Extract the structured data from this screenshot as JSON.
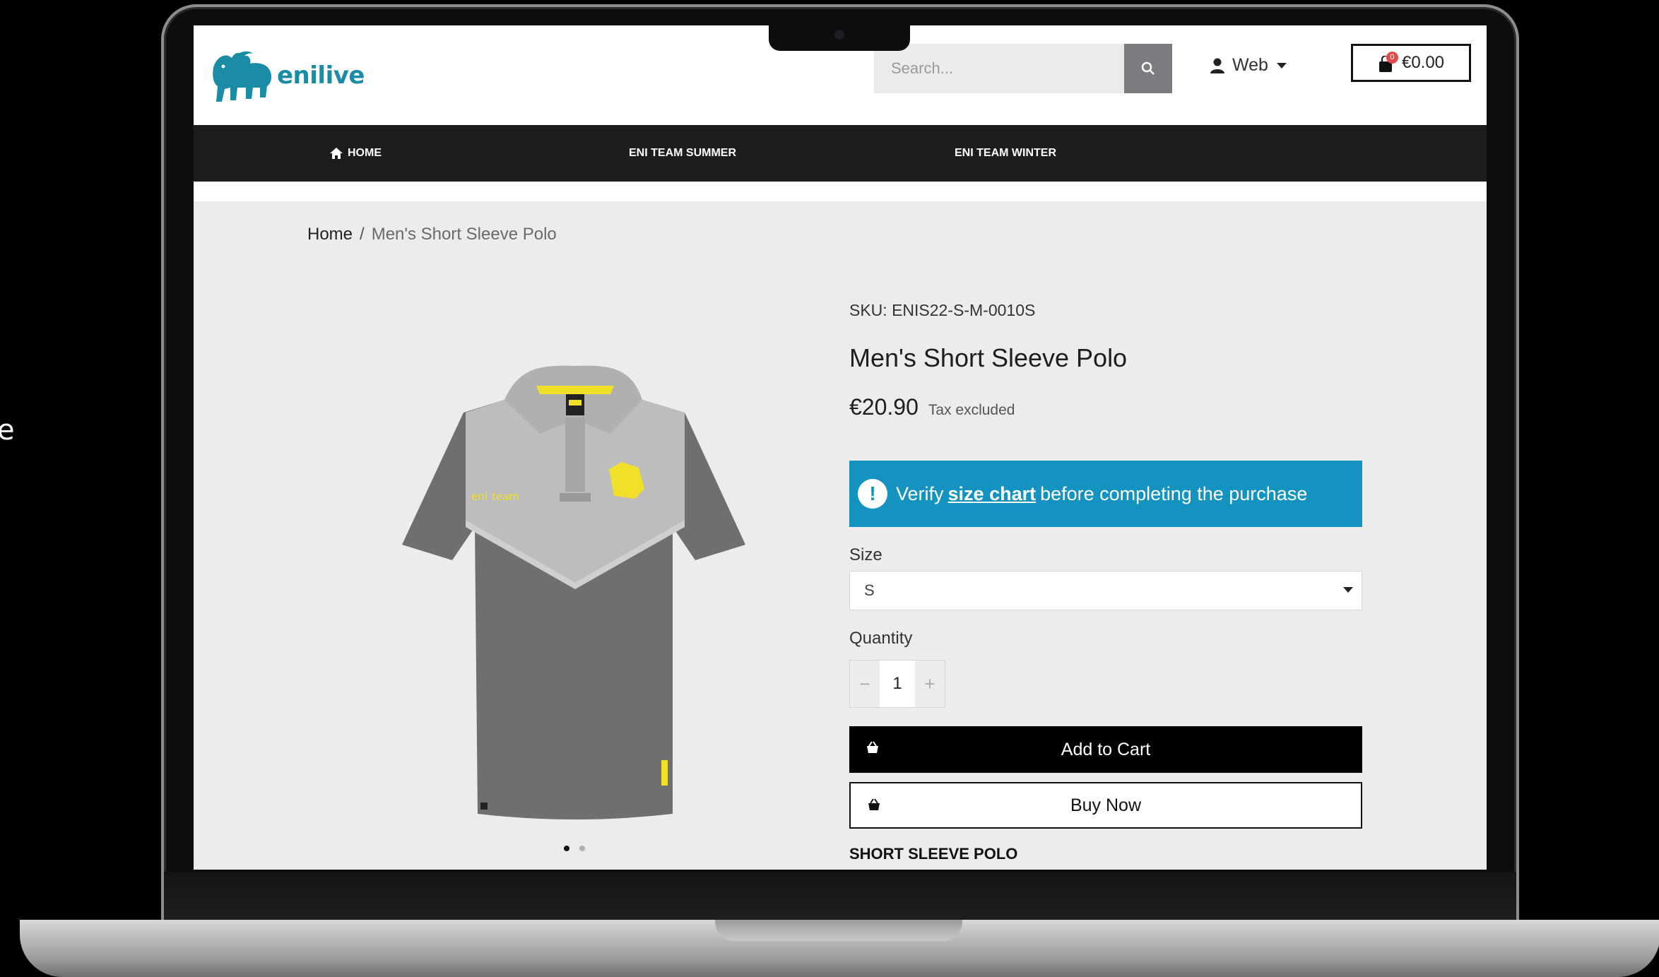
{
  "backdrop": {
    "side_text": "e"
  },
  "header": {
    "brand": "enilive",
    "search_placeholder": "Search...",
    "account_label": "Web",
    "cart_count": "0",
    "cart_total": "€0.00"
  },
  "nav": {
    "items": [
      {
        "label": "HOME",
        "icon": "home-icon"
      },
      {
        "label": "ENI TEAM SUMMER"
      },
      {
        "label": "ENI TEAM WINTER"
      }
    ]
  },
  "breadcrumb": {
    "home": "Home",
    "separator": "/",
    "current": "Men's Short Sleeve Polo"
  },
  "product": {
    "sku": "SKU: ENIS22-S-M-0010S",
    "title": "Men's Short Sleeve Polo",
    "price": "€20.90",
    "tax_note": "Tax excluded",
    "alert": {
      "prefix": "Verify",
      "link": "size chart",
      "suffix": "before completing the purchase"
    },
    "size_label": "Size",
    "size_value": "S",
    "quantity_label": "Quantity",
    "quantity_value": "1",
    "qty_minus": "−",
    "qty_plus": "+",
    "add_to_cart": "Add to Cart",
    "buy_now": "Buy Now",
    "description_heading": "SHORT SLEEVE POLO",
    "image_count": 2,
    "active_image": 1
  },
  "colors": {
    "brand": "#1b8ca5",
    "nav_bg": "#1d1d1f",
    "alert_bg": "#1593c0",
    "cart_badge": "#e24a4a",
    "logo_yellow": "#f1e02a"
  }
}
